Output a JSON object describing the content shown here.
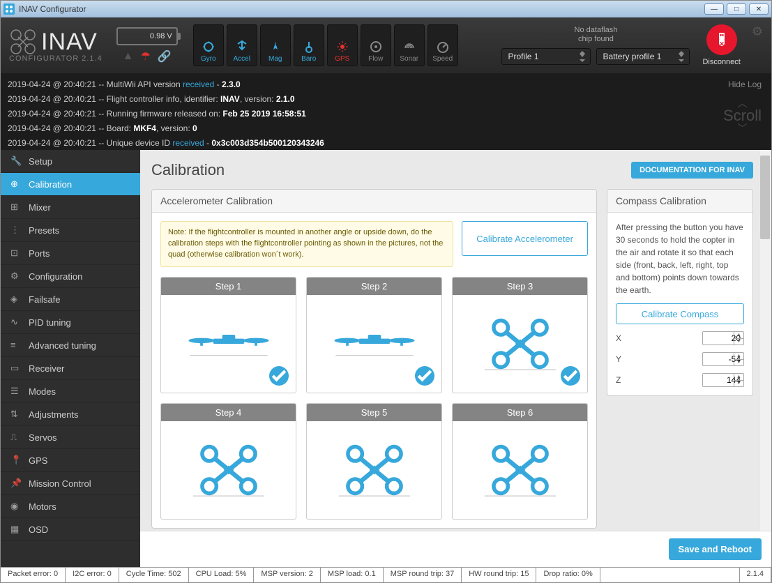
{
  "app": {
    "title": "INAV Configurator",
    "logo_name": "INAV",
    "logo_sub": "CONFIGURATOR  2.1.4"
  },
  "battery": {
    "voltage": "0.98 V"
  },
  "sensors": [
    {
      "id": "gyro",
      "label": "Gyro",
      "state": "active"
    },
    {
      "id": "accel",
      "label": "Accel",
      "state": "active"
    },
    {
      "id": "mag",
      "label": "Mag",
      "state": "active"
    },
    {
      "id": "baro",
      "label": "Baro",
      "state": "active"
    },
    {
      "id": "gps",
      "label": "GPS",
      "state": "gps"
    },
    {
      "id": "flow",
      "label": "Flow",
      "state": "off"
    },
    {
      "id": "sonar",
      "label": "Sonar",
      "state": "off"
    },
    {
      "id": "speed",
      "label": "Speed",
      "state": "off"
    }
  ],
  "dataflash": {
    "line1": "No dataflash",
    "line2": "chip found"
  },
  "profiles": {
    "p1": "Profile 1",
    "p2": "Battery profile 1"
  },
  "disconnect": "Disconnect",
  "log_hide": "Hide Log",
  "log_scroll": "Scroll",
  "log": [
    {
      "ts": "2019-04-24 @ 20:40:21",
      "pre": "MultiWii API version ",
      "blue": "received",
      "post": " - ",
      "bold": "2.3.0"
    },
    {
      "ts": "2019-04-24 @ 20:40:21",
      "pre": "Flight controller info, identifier: ",
      "bold": "INAV",
      "post2": ", version: ",
      "bold2": "2.1.0"
    },
    {
      "ts": "2019-04-24 @ 20:40:21",
      "pre": "Running firmware released on: ",
      "bold": "Feb 25 2019 16:58:51"
    },
    {
      "ts": "2019-04-24 @ 20:40:21",
      "pre": "Board: ",
      "bold": "MKF4",
      "post2": ", version: ",
      "bold2": "0"
    },
    {
      "ts": "2019-04-24 @ 20:40:21",
      "pre": "Unique device ID ",
      "blue": "received",
      "post": " - ",
      "bold": "0x3c003d354b500120343246"
    }
  ],
  "sidebar": [
    {
      "id": "setup",
      "label": "Setup"
    },
    {
      "id": "calibration",
      "label": "Calibration",
      "active": true
    },
    {
      "id": "mixer",
      "label": "Mixer"
    },
    {
      "id": "presets",
      "label": "Presets"
    },
    {
      "id": "ports",
      "label": "Ports"
    },
    {
      "id": "configuration",
      "label": "Configuration"
    },
    {
      "id": "failsafe",
      "label": "Failsafe"
    },
    {
      "id": "pid",
      "label": "PID tuning"
    },
    {
      "id": "adv",
      "label": "Advanced tuning"
    },
    {
      "id": "receiver",
      "label": "Receiver"
    },
    {
      "id": "modes",
      "label": "Modes"
    },
    {
      "id": "adjustments",
      "label": "Adjustments"
    },
    {
      "id": "servos",
      "label": "Servos"
    },
    {
      "id": "gps",
      "label": "GPS"
    },
    {
      "id": "mission",
      "label": "Mission Control"
    },
    {
      "id": "motors",
      "label": "Motors"
    },
    {
      "id": "osd",
      "label": "OSD"
    }
  ],
  "page": {
    "title": "Calibration",
    "doc_btn": "DOCUMENTATION FOR INAV",
    "accel_panel": "Accelerometer Calibration",
    "note": "Note: If the flightcontroller is mounted in another angle or upside down, do the calibration steps with the flightcontroller pointing as shown in the pictures, not the quad (otherwise calibration won´t work).",
    "cal_accel_btn": "Calibrate Accelerometer",
    "steps": [
      "Step 1",
      "Step 2",
      "Step 3",
      "Step 4",
      "Step 5",
      "Step 6"
    ],
    "compass_panel": "Compass Calibration",
    "compass_text": "After pressing the button you have 30 seconds to hold the copter in the air and rotate it so that each side (front, back, left, right, top and bottom) points down towards the earth.",
    "cal_compass_btn": "Calibrate Compass",
    "axes": {
      "x_label": "X",
      "x": "20",
      "y_label": "Y",
      "y": "-54",
      "z_label": "Z",
      "z": "144"
    },
    "save_btn": "Save and Reboot"
  },
  "status": {
    "packet": "Packet error: 0",
    "i2c": "I2C error: 0",
    "cycle": "Cycle Time: 502",
    "cpu": "CPU Load: 5%",
    "mspv": "MSP version: 2",
    "mspl": "MSP load: 0.1",
    "msprt": "MSP round trip: 37",
    "hwrt": "HW round trip: 15",
    "drop": "Drop ratio: 0%",
    "ver": "2.1.4"
  }
}
